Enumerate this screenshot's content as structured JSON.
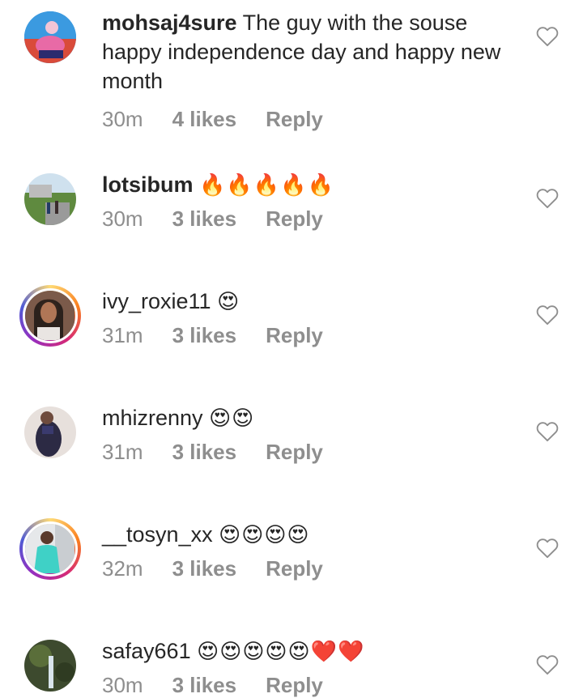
{
  "comments": [
    {
      "username": "mohsaj4sure",
      "text": "The guy with the souse happy independence day and happy new month",
      "time": "30m",
      "likes": "4 likes",
      "reply": "Reply",
      "emoji": ""
    },
    {
      "username": "lotsibum",
      "text": "",
      "emoji": "🔥🔥🔥🔥🔥",
      "time": "30m",
      "likes": "3 likes",
      "reply": "Reply"
    },
    {
      "username": "ivy_roxie11",
      "text": "",
      "emoji": "😍",
      "time": "31m",
      "likes": "3 likes",
      "reply": "Reply"
    },
    {
      "username": "mhizrenny",
      "text": "",
      "emoji": "😍😍",
      "time": "31m",
      "likes": "3 likes",
      "reply": "Reply"
    },
    {
      "username": "__tosyn_xx",
      "text": "",
      "emoji": "😍😍😍😍",
      "time": "32m",
      "likes": "3 likes",
      "reply": "Reply"
    },
    {
      "username": "safay661",
      "text": "",
      "emoji": "😍😍😍😍😍❤️❤️",
      "time": "30m",
      "likes": "3 likes",
      "reply": "Reply"
    }
  ],
  "icons": {
    "like": "heart-outline-icon"
  },
  "colors": {
    "text": "#262626",
    "secondary": "#8e8e8e",
    "story_ring_start": "#feda75",
    "story_ring_end": "#962fbf"
  }
}
